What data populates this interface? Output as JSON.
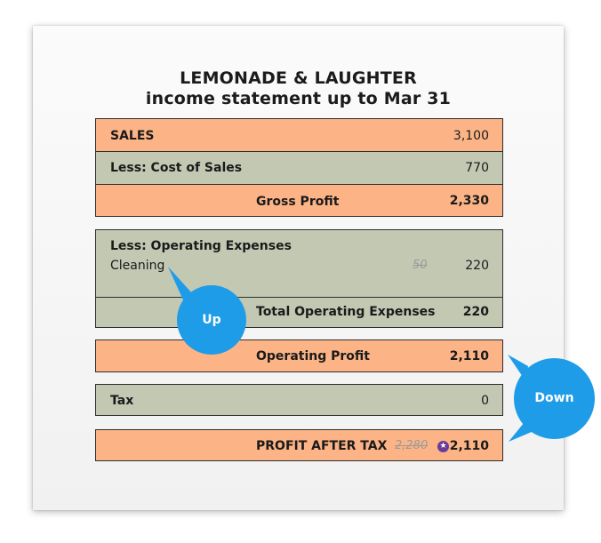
{
  "header": {
    "company": "LEMONADE & LAUGHTER",
    "subtitle": "income statement up to Mar 31"
  },
  "sales": {
    "label": "SALES",
    "value": "3,100",
    "cost_label": "Less: Cost of Sales",
    "cost_value": "770",
    "gross_label": "Gross Profit",
    "gross_value": "2,330"
  },
  "operating_expenses": {
    "heading": "Less: Operating Expenses",
    "item_label": "Cleaning",
    "item_old_value": "50",
    "item_value": "220",
    "total_label": "Total Operating Expenses",
    "total_value": "220"
  },
  "operating_profit": {
    "label": "Operating Profit",
    "value": "2,110"
  },
  "tax": {
    "label": "Tax",
    "value": "0"
  },
  "profit_after_tax": {
    "label": "PROFIT AFTER TAX",
    "old_value": "2,280",
    "value": "2,110"
  },
  "callouts": {
    "up": "Up",
    "down": "Down"
  },
  "colors": {
    "orange_row": "#fcb487",
    "green_row": "#c3c8b3",
    "callout_blue": "#1f9ce8",
    "badge_purple": "#6a3c98"
  }
}
